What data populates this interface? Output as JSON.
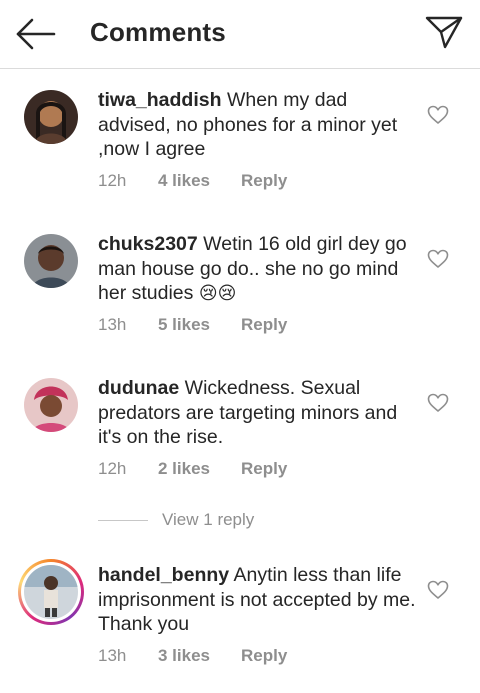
{
  "header": {
    "title": "Comments",
    "back_icon": "arrow-left-icon",
    "send_icon": "paper-plane-icon"
  },
  "comments": [
    {
      "username": "tiwa_haddish",
      "text": "When my dad advised, no phones for a minor yet ,now I agree",
      "time": "12h",
      "likes": "4 likes",
      "reply": "Reply"
    },
    {
      "username": "chuks2307",
      "text": "Wetin 16 old girl dey go man house go do.. she no go mind her studies",
      "emoji": "😢😢",
      "time": "13h",
      "likes": "5 likes",
      "reply": "Reply"
    },
    {
      "username": "dudunae",
      "text": "Wickedness. Sexual predators are targeting minors and it's on the rise.",
      "time": "12h",
      "likes": "2 likes",
      "reply": "Reply",
      "view_replies": "View 1 reply"
    },
    {
      "username": "handel_benny",
      "text": "Anytin less than life imprisonment is not accepted by me. Thank you",
      "time": "13h",
      "likes": "3 likes",
      "reply": "Reply",
      "has_story_ring": true
    }
  ],
  "colors": {
    "text": "#262626",
    "secondary": "#8e8e8e",
    "divider": "#dbdbdb"
  }
}
